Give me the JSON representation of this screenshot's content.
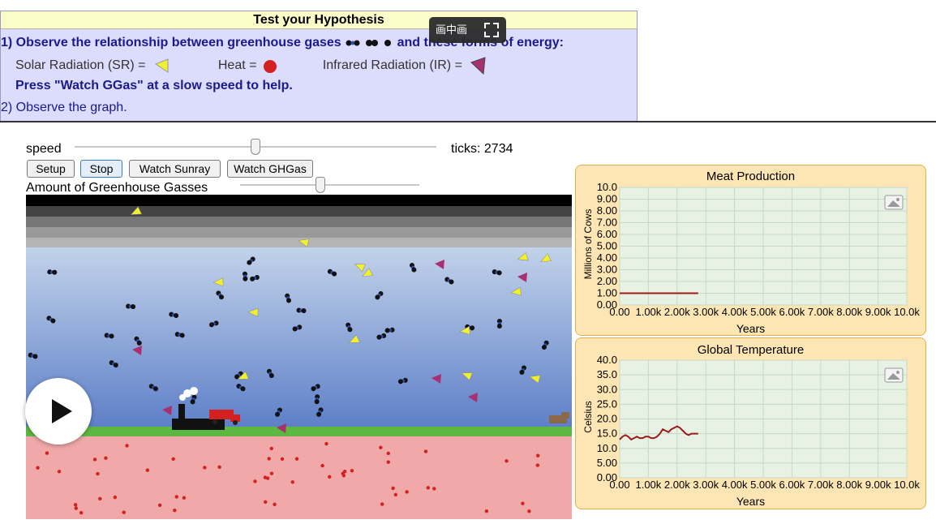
{
  "hypothesis": {
    "title": "Test your Hypothesis",
    "line1_start": "1) Observe the relationship between greenhouse gases",
    "line1_end": "and these forms of energy:",
    "sr_label": "Solar Radiation (SR) =",
    "heat_label": "Heat =",
    "ir_label": "Infrared Radiation (IR) =",
    "press_hint": "Press \"Watch GGas\" at a slow speed to help.",
    "line2": "2) Observe the graph."
  },
  "overlay": {
    "pip_label": "画中画",
    "pip_icon": "expand-icon",
    "play_icon": "play-icon"
  },
  "controls": {
    "speed_label": "speed",
    "speed_value": 0.5,
    "ticks_label": "ticks: 2734",
    "buttons": [
      "Setup",
      "Stop",
      "Watch Sunray",
      "Watch GHGas"
    ],
    "greenhouse_label": "Amount of Greenhouse Gasses",
    "greenhouse_value": 0.45
  },
  "colors": {
    "solar": "#f0f030",
    "heat": "#d42020",
    "infrared": "#a83070",
    "ground": "#f0a8a8",
    "grass": "#5cb840",
    "plot_bg": "#fde6b3",
    "plot_line": "#9c1a1a"
  },
  "chart_data": [
    {
      "type": "line",
      "title": "Meat Production",
      "xlabel": "Years",
      "ylabel": "Millions of Cows",
      "xlim": [
        0,
        10000
      ],
      "ylim": [
        0,
        10
      ],
      "x_ticks": [
        "0.00",
        "1.00k",
        "2.00k",
        "3.00k",
        "4.00k",
        "5.00k",
        "6.00k",
        "7.00k",
        "8.00k",
        "9.00k",
        "10.0k"
      ],
      "y_ticks": [
        "0.00",
        "1.00",
        "2.00",
        "3.00",
        "4.00",
        "5.00",
        "6.00",
        "7.00",
        "8.00",
        "9.00",
        "10.0"
      ],
      "series": [
        {
          "x": [
            0,
            500,
            1000,
            1500,
            2000,
            2500,
            2734
          ],
          "y": [
            1,
            1,
            1,
            1,
            1,
            1,
            1
          ]
        }
      ]
    },
    {
      "type": "line",
      "title": "Global Temperature",
      "xlabel": "Years",
      "ylabel": "Celsius",
      "xlim": [
        0,
        10000
      ],
      "ylim": [
        0,
        40
      ],
      "x_ticks": [
        "0.00",
        "1.00k",
        "2.00k",
        "3.00k",
        "4.00k",
        "5.00k",
        "6.00k",
        "7.00k",
        "8.00k",
        "9.00k",
        "10.0k"
      ],
      "y_ticks": [
        "0.00",
        "5.00",
        "10.0",
        "15.0",
        "20.0",
        "25.0",
        "30.0",
        "35.0",
        "40.0"
      ],
      "series": [
        {
          "x": [
            0,
            100,
            200,
            300,
            400,
            500,
            600,
            700,
            800,
            900,
            1000,
            1100,
            1200,
            1300,
            1400,
            1500,
            1600,
            1700,
            1800,
            1900,
            2000,
            2100,
            2200,
            2300,
            2400,
            2500,
            2600,
            2700,
            2734
          ],
          "y": [
            13,
            14,
            14.5,
            14,
            13,
            13.5,
            14,
            13.5,
            13.5,
            14,
            14,
            13.5,
            13.5,
            14,
            15,
            16.5,
            16,
            15.5,
            16.5,
            17,
            17.5,
            17,
            16,
            15,
            14.5,
            15,
            15,
            15,
            15
          ]
        }
      ]
    }
  ]
}
